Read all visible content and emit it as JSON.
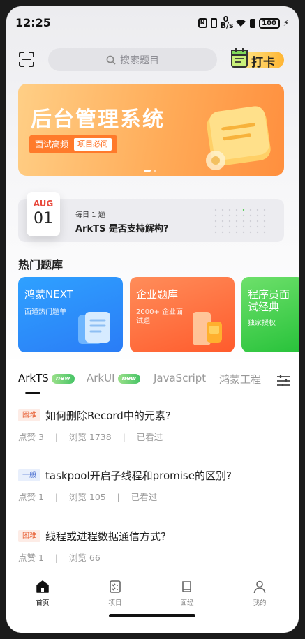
{
  "status_bar": {
    "time": "12:25",
    "net_speed_top": "0",
    "net_speed_unit": "B/s",
    "battery": "100"
  },
  "header": {
    "search_placeholder": "搜索题目",
    "checkin_label": "打卡"
  },
  "banner": {
    "title": "后台管理系统",
    "tag_main": "面试高频",
    "tag_sub": "项目必问"
  },
  "daily": {
    "month": "AUG",
    "day": "01",
    "subtitle": "每日 1 题",
    "question": "ArkTS 是否支持解构?"
  },
  "hot": {
    "title": "热门题库",
    "cards": [
      {
        "title": "鸿蒙NEXT",
        "sub": "面通热门题单",
        "color": "#2a8cfb"
      },
      {
        "title": "企业题库",
        "sub1": "2000+ 企业面",
        "sub2": "试题",
        "color": "#ff6a36"
      },
      {
        "title": "程序员面",
        "title2": "试经典",
        "sub": "独家授权",
        "color": "#3ccc4a"
      }
    ]
  },
  "tabs": [
    {
      "label": "ArkTS",
      "badge": "new",
      "active": true
    },
    {
      "label": "ArkUI",
      "badge": "new",
      "active": false
    },
    {
      "label": "JavaScript",
      "badge": "",
      "active": false
    },
    {
      "label": "鸿蒙工程",
      "badge": "",
      "active": false
    }
  ],
  "questions": [
    {
      "level": "困难",
      "title": "如何删除Record中的元素?",
      "meta": "点赞 3    |    浏览 1738    |    已看过"
    },
    {
      "level": "一般",
      "title": "taskpool开启子线程和promise的区别?",
      "meta": "点赞 1    |    浏览 105    |    已看过"
    },
    {
      "level": "困难",
      "title": "线程或进程数据通信方式?",
      "meta": "点赞 1    |    浏览 66"
    }
  ],
  "nav": [
    {
      "label": "首页",
      "icon": "home-icon",
      "active": true
    },
    {
      "label": "项目",
      "icon": "project-icon",
      "active": false
    },
    {
      "label": "面经",
      "icon": "book-icon",
      "active": false
    },
    {
      "label": "我的",
      "icon": "user-icon",
      "active": false
    }
  ],
  "colors": {
    "accent_orange": "#ff8f3e",
    "hard_badge": "#e8643a",
    "normal_badge": "#4a6fd0"
  }
}
